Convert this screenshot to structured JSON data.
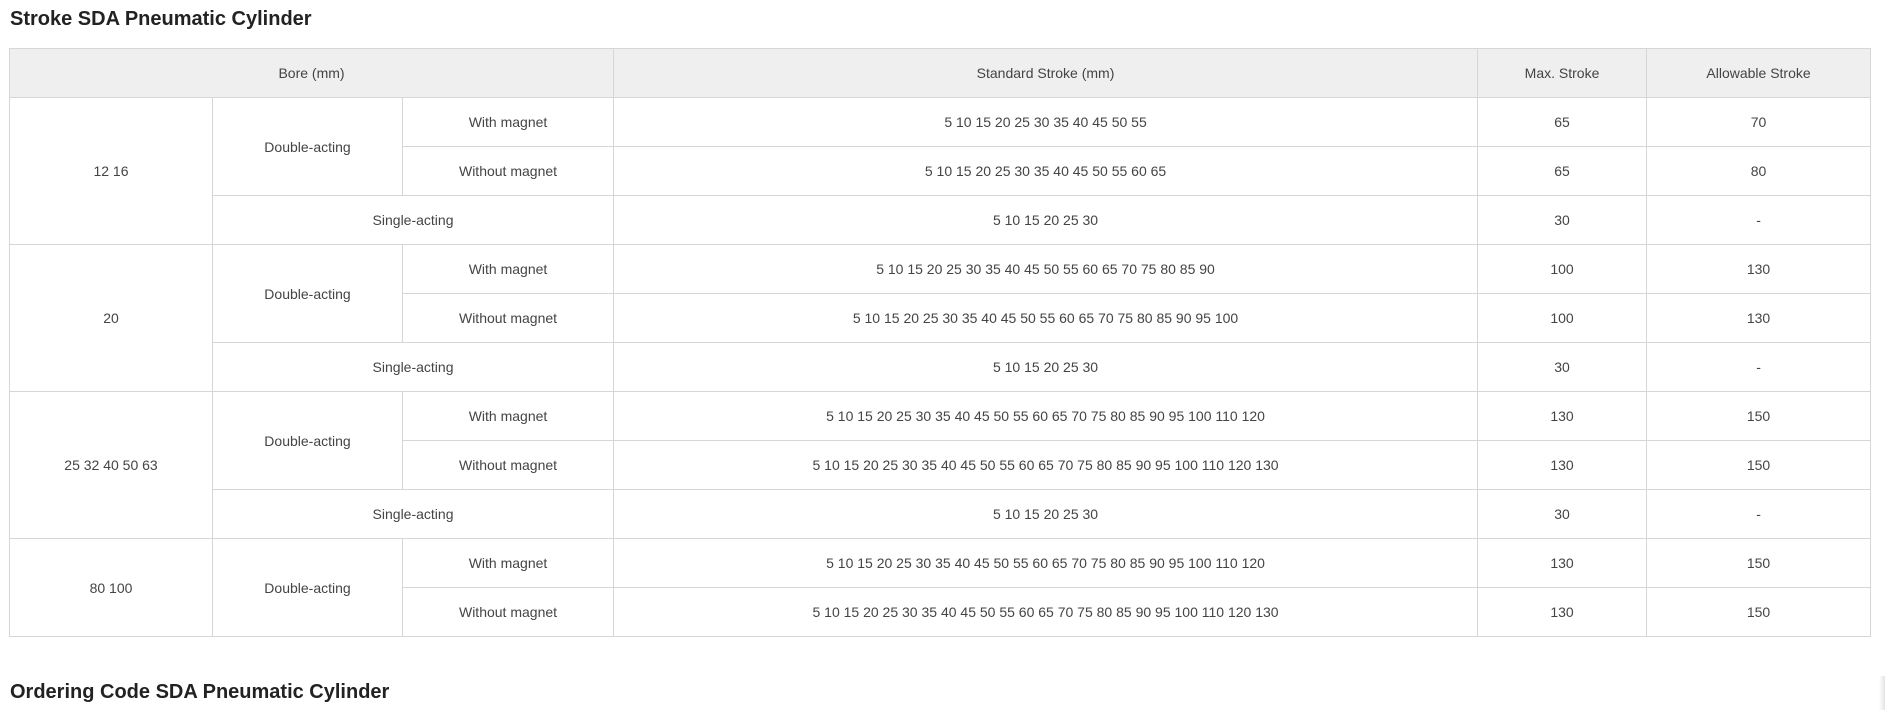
{
  "sections": {
    "stroke_title": "Stroke SDA Pneumatic Cylinder",
    "ordering_title": "Ordering Code SDA Pneumatic Cylinder"
  },
  "table": {
    "headers": {
      "bore": "Bore (mm)",
      "standard_stroke": "Standard Stroke (mm)",
      "max_stroke": "Max. Stroke",
      "allowable_stroke": "Allowable Stroke"
    },
    "groups": [
      {
        "bore": "12 16",
        "rows": {
          "double_with": {
            "action": "Double-acting",
            "magnet": "With magnet",
            "standard": "5 10 15 20 25 30 35 40 45 50 55",
            "max": "65",
            "allowable": "70"
          },
          "double_without": {
            "magnet": "Without magnet",
            "standard": "5 10 15 20 25 30 35 40 45 50 55 60 65",
            "max": "65",
            "allowable": "80"
          },
          "single": {
            "action": "Single-acting",
            "standard": "5 10 15 20 25 30",
            "max": "30",
            "allowable": "-"
          }
        }
      },
      {
        "bore": "20",
        "rows": {
          "double_with": {
            "action": "Double-acting",
            "magnet": "With magnet",
            "standard": "5 10 15 20 25 30 35 40 45 50 55 60 65 70 75 80 85 90",
            "max": "100",
            "allowable": "130"
          },
          "double_without": {
            "magnet": "Without magnet",
            "standard": "5 10 15 20 25 30 35 40 45 50 55 60 65 70 75 80 85 90 95 100",
            "max": "100",
            "allowable": "130"
          },
          "single": {
            "action": "Single-acting",
            "standard": "5 10 15 20 25 30",
            "max": "30",
            "allowable": "-"
          }
        }
      },
      {
        "bore": "25 32 40 50 63",
        "rows": {
          "double_with": {
            "action": "Double-acting",
            "magnet": "With magnet",
            "standard": "5 10 15 20 25 30 35 40 45 50 55 60 65 70 75 80 85 90 95 100 110 120",
            "max": "130",
            "allowable": "150"
          },
          "double_without": {
            "magnet": "Without magnet",
            "standard": "5 10 15 20 25 30 35 40 45 50 55 60 65 70 75 80 85 90 95 100 110 120 130",
            "max": "130",
            "allowable": "150"
          },
          "single": {
            "action": "Single-acting",
            "standard": "5 10 15 20 25 30",
            "max": "30",
            "allowable": "-"
          }
        }
      },
      {
        "bore": "80 100",
        "rows": {
          "double_with": {
            "action": "Double-acting",
            "magnet": "With magnet",
            "standard": "5 10 15 20 25 30 35 40 45 50 55 60 65 70 75 80 85 90 95 100 110 120",
            "max": "130",
            "allowable": "150"
          },
          "double_without": {
            "magnet": "Without magnet",
            "standard": "5 10 15 20 25 30 35 40 45 50 55 60 65 70 75 80 85 90 95 100 110 120 130",
            "max": "130",
            "allowable": "150"
          }
        }
      }
    ]
  }
}
